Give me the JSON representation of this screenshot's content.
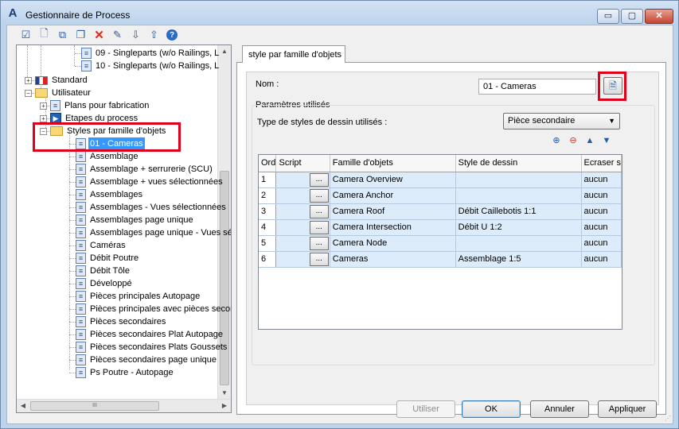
{
  "window": {
    "title": "Gestionnaire de Process",
    "app_icon": "A",
    "buttons": {
      "minimize": "▭",
      "maximize": "▢",
      "close": "✕"
    }
  },
  "toolbar": {
    "icons": [
      "checklist-icon",
      "new-document-icon",
      "copy-icon",
      "duplicate-icon",
      "delete-icon",
      "rename-icon",
      "import-icon",
      "export-icon",
      "help-icon"
    ]
  },
  "tree": {
    "items": [
      {
        "label": "09 - Singleparts (w/o Railings, L",
        "icon": "doc"
      },
      {
        "label": "10 - Singleparts (w/o Railings, L",
        "icon": "doc"
      },
      {
        "label": "Standard",
        "icon": "flag",
        "expander": "+"
      },
      {
        "label": "Utilisateur",
        "icon": "folder",
        "expander": "−"
      },
      {
        "label": "Plans pour fabrication",
        "icon": "doc",
        "expander": "+"
      },
      {
        "label": "Etapes du process",
        "icon": "dev",
        "expander": "+"
      },
      {
        "label": "Styles par famille d'objets",
        "icon": "folder",
        "expander": "−"
      },
      {
        "label": "01 - Cameras",
        "icon": "doc",
        "selected": true
      },
      {
        "label": "Assemblage",
        "icon": "doc"
      },
      {
        "label": "Assemblage + serrurerie (SCU)",
        "icon": "doc"
      },
      {
        "label": "Assemblage + vues sélectionnées",
        "icon": "doc"
      },
      {
        "label": "Assemblages",
        "icon": "doc"
      },
      {
        "label": "Assemblages - Vues sélectionnées",
        "icon": "doc"
      },
      {
        "label": "Assemblages page unique",
        "icon": "doc"
      },
      {
        "label": "Assemblages page unique - Vues sé",
        "icon": "doc"
      },
      {
        "label": "Caméras",
        "icon": "doc"
      },
      {
        "label": "Débit Poutre",
        "icon": "doc"
      },
      {
        "label": "Débit Tôle",
        "icon": "doc"
      },
      {
        "label": "Développé",
        "icon": "doc"
      },
      {
        "label": "Pièces principales Autopage",
        "icon": "doc"
      },
      {
        "label": "Pièces principales avec pièces secon",
        "icon": "doc"
      },
      {
        "label": "Pièces secondaires",
        "icon": "doc"
      },
      {
        "label": "Pièces secondaires Plat Autopage",
        "icon": "doc"
      },
      {
        "label": "Pièces secondaires Plats Goussets",
        "icon": "doc"
      },
      {
        "label": "Pièces secondaires page unique",
        "icon": "doc"
      },
      {
        "label": "Ps Poutre - Autopage",
        "icon": "doc"
      }
    ],
    "hscroll_grip": "III"
  },
  "tab": {
    "label": "style par famille d'objets"
  },
  "form": {
    "name_label": "Nom :",
    "name_value": "01 - Cameras",
    "group_label": "Paramètres utilisés",
    "type_label": "Type de styles de dessin utilisés :",
    "type_value": "Pièce secondaire",
    "grid_icons": [
      "add-row-icon",
      "delete-row-icon",
      "move-up-icon",
      "move-down-icon"
    ]
  },
  "grid": {
    "columns": [
      "Ord",
      "Script",
      "Famille d'objets",
      "Style de dessin",
      "Ecraser s"
    ],
    "button_label": "...",
    "rows": [
      {
        "ord": "1",
        "famille": "Camera Overview",
        "style": "",
        "ecraser": "aucun"
      },
      {
        "ord": "2",
        "famille": "Camera Anchor",
        "style": "",
        "ecraser": "aucun"
      },
      {
        "ord": "3",
        "famille": "Camera Roof",
        "style": "Débit Caillebotis 1:1",
        "ecraser": "aucun"
      },
      {
        "ord": "4",
        "famille": "Camera Intersection",
        "style": "Débit U 1:2",
        "ecraser": "aucun"
      },
      {
        "ord": "5",
        "famille": "Camera Node",
        "style": "",
        "ecraser": "aucun"
      },
      {
        "ord": "6",
        "famille": "Cameras",
        "style": "Assemblage 1:5",
        "ecraser": "aucun"
      }
    ]
  },
  "buttons": {
    "utiliser": "Utiliser",
    "ok": "OK",
    "annuler": "Annuler",
    "appliquer": "Appliquer"
  }
}
